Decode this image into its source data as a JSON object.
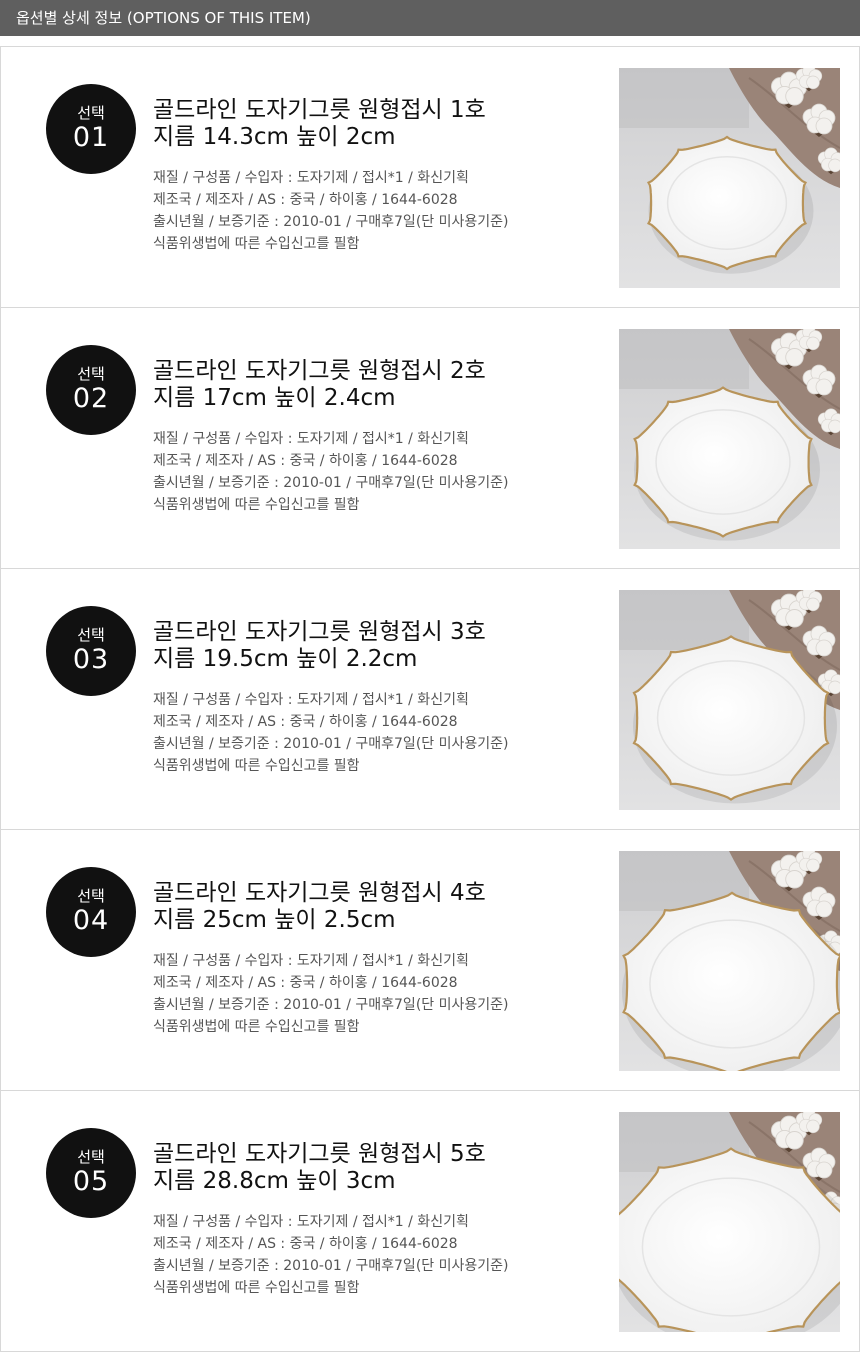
{
  "header": {
    "title": "옵션별 상세 정보 (OPTIONS OF THIS ITEM)"
  },
  "options": [
    {
      "badge_label": "선택",
      "badge_number": "01",
      "title": "골드라인 도자기그릇 원형접시 1호",
      "size": "지름 14.3cm 높이 2cm",
      "specs": [
        "재질 / 구성품 / 수입자 : 도자기제 / 접시*1 / 화신기획",
        "제조국 / 제조자 / AS : 중국 / 하이홍 / 1644-6028",
        "출시년월 / 보증기준 : 2010-01 / 구매후7일(단 미사용기준)",
        "식품위생법에 따른 수입신고를 필함"
      ]
    },
    {
      "badge_label": "선택",
      "badge_number": "02",
      "title": "골드라인 도자기그릇 원형접시 2호",
      "size": "지름 17cm 높이 2.4cm",
      "specs": [
        "재질 / 구성품 / 수입자 : 도자기제 / 접시*1 / 화신기획",
        "제조국 / 제조자 / AS : 중국 / 하이홍 / 1644-6028",
        "출시년월 / 보증기준 : 2010-01 / 구매후7일(단 미사용기준)",
        "식품위생법에 따른 수입신고를 필함"
      ]
    },
    {
      "badge_label": "선택",
      "badge_number": "03",
      "title": "골드라인 도자기그릇 원형접시 3호",
      "size": "지름 19.5cm 높이 2.2cm",
      "specs": [
        "재질 / 구성품 / 수입자 : 도자기제 / 접시*1 / 화신기획",
        "제조국 / 제조자 / AS : 중국 / 하이홍 / 1644-6028",
        "출시년월 / 보증기준 : 2010-01 / 구매후7일(단 미사용기준)",
        "식품위생법에 따른 수입신고를 필함"
      ]
    },
    {
      "badge_label": "선택",
      "badge_number": "04",
      "title": "골드라인 도자기그릇 원형접시 4호",
      "size": "지름 25cm 높이 2.5cm",
      "specs": [
        "재질 / 구성품 / 수입자 : 도자기제 / 접시*1 / 화신기획",
        "제조국 / 제조자 / AS : 중국 / 하이홍 / 1644-6028",
        "출시년월 / 보증기준 : 2010-01 / 구매후7일(단 미사용기준)",
        "식품위생법에 따른 수입신고를 필함"
      ]
    },
    {
      "badge_label": "선택",
      "badge_number": "05",
      "title": "골드라인 도자기그릇 원형접시 5호",
      "size": "지름 28.8cm 높이 3cm",
      "specs": [
        "재질 / 구성품 / 수입자 : 도자기제 / 접시*1 / 화신기획",
        "제조국 / 제조자 / AS : 중국 / 하이홍 / 1644-6028",
        "출시년월 / 보증기준 : 2010-01 / 구매후7일(단 미사용기준)",
        "식품위생법에 따른 수입신고를 필함"
      ]
    }
  ],
  "colors": {
    "header_bg": "#5f5f5f",
    "badge_bg": "#111111",
    "plate_rim": "#b8945a"
  }
}
